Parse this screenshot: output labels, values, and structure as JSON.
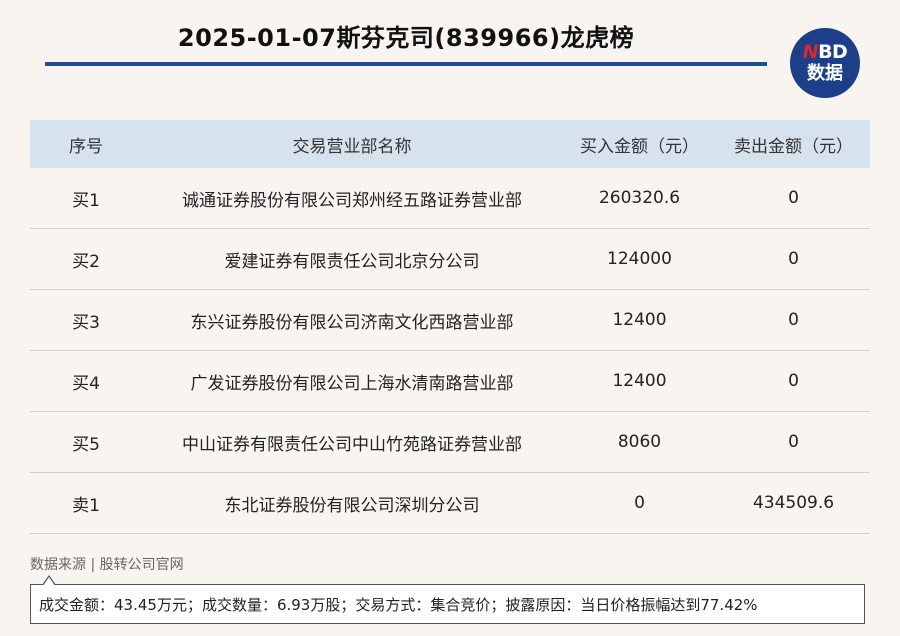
{
  "title": "2025-01-07斯芬克司(839966)龙虎榜",
  "logo": {
    "line1_n": "N",
    "line1_rest": "BD",
    "line2": "数据"
  },
  "table": {
    "headers": [
      "序号",
      "交易营业部名称",
      "买入金额（元）",
      "卖出金额（元）"
    ],
    "rows": [
      [
        "买1",
        "诚通证券股份有限公司郑州经五路证券营业部",
        "260320.6",
        "0"
      ],
      [
        "买2",
        "爱建证券有限责任公司北京分公司",
        "124000",
        "0"
      ],
      [
        "买3",
        "东兴证券股份有限公司济南文化西路营业部",
        "12400",
        "0"
      ],
      [
        "买4",
        "广发证券股份有限公司上海水清南路营业部",
        "12400",
        "0"
      ],
      [
        "买5",
        "中山证券有限责任公司中山竹苑路证券营业部",
        "8060",
        "0"
      ],
      [
        "卖1",
        "东北证券股份有限公司深圳分公司",
        "0",
        "434509.6"
      ]
    ]
  },
  "source": "数据来源 | 股转公司官网",
  "summary": "成交金额：43.45万元；成交数量：6.93万股；交易方式：集合竞价；披露原因：当日价格振幅达到77.42%",
  "colors": {
    "accent": "#1d4f91",
    "header_bg": "#d6e2ee",
    "logo_bg": "#1d3f8a",
    "logo_n": "#e0262a"
  }
}
